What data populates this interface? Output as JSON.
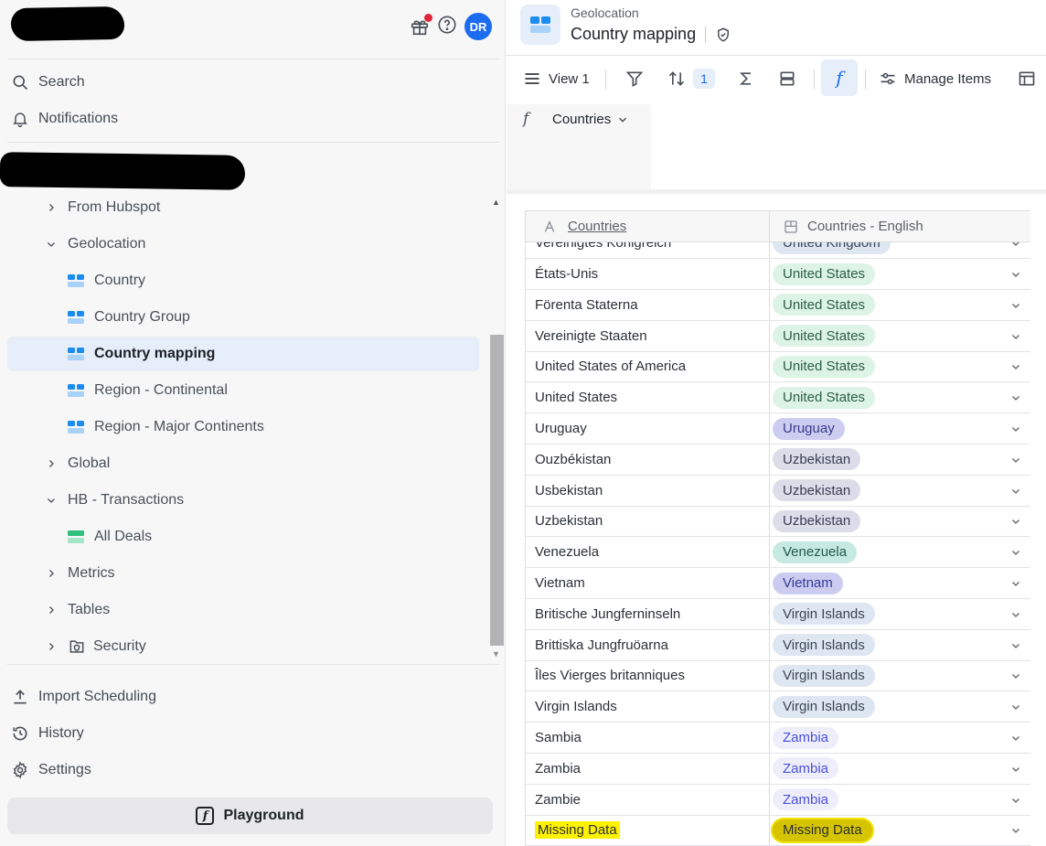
{
  "sidebar": {
    "avatar_initials": "DR",
    "nav": {
      "search": "Search",
      "notifications": "Notifications"
    },
    "tree": [
      {
        "label": "From Hubspot",
        "level": 1,
        "kind": "folder",
        "expanded": false
      },
      {
        "label": "Geolocation",
        "level": 1,
        "kind": "folder",
        "expanded": true
      },
      {
        "label": "Country",
        "level": 2,
        "kind": "table"
      },
      {
        "label": "Country Group",
        "level": 2,
        "kind": "table"
      },
      {
        "label": "Country mapping",
        "level": 2,
        "kind": "table",
        "selected": true
      },
      {
        "label": "Region - Continental",
        "level": 2,
        "kind": "table"
      },
      {
        "label": "Region - Major Continents",
        "level": 2,
        "kind": "table"
      },
      {
        "label": "Global",
        "level": 1,
        "kind": "folder",
        "expanded": false
      },
      {
        "label": "HB - Transactions",
        "level": 1,
        "kind": "folder",
        "expanded": true
      },
      {
        "label": "All Deals",
        "level": 2,
        "kind": "table-green"
      },
      {
        "label": "Metrics",
        "level": 1,
        "kind": "folder",
        "expanded": false
      },
      {
        "label": "Tables",
        "level": 1,
        "kind": "folder",
        "expanded": false
      },
      {
        "label": "Security",
        "level": 1,
        "kind": "folder-security",
        "expanded": false
      }
    ],
    "bottom": {
      "import_scheduling": "Import Scheduling",
      "history": "History",
      "settings": "Settings",
      "playground": "Playground"
    }
  },
  "header": {
    "subtitle": "Geolocation",
    "title": "Country mapping"
  },
  "toolbar": {
    "view_label": "View 1",
    "sort_count": "1",
    "manage_items": "Manage Items"
  },
  "formula": {
    "column_name": "Countries"
  },
  "table": {
    "columns": [
      "Countries",
      "Countries - English"
    ],
    "partial_row": {
      "c1": "Vereinigtes Königreich",
      "c2": "United Kingdom",
      "color": "uk"
    },
    "rows": [
      {
        "c1": "États-Unis",
        "c2": "United States",
        "color": "us"
      },
      {
        "c1": "Förenta Staterna",
        "c2": "United States",
        "color": "us"
      },
      {
        "c1": "Vereinigte Staaten",
        "c2": "United States",
        "color": "us"
      },
      {
        "c1": "United States of America",
        "c2": "United States",
        "color": "us"
      },
      {
        "c1": "United States",
        "c2": "United States",
        "color": "us"
      },
      {
        "c1": "Uruguay",
        "c2": "Uruguay",
        "color": "uy"
      },
      {
        "c1": "Ouzbékistan",
        "c2": "Uzbekistan",
        "color": "uz"
      },
      {
        "c1": "Usbekistan",
        "c2": "Uzbekistan",
        "color": "uz"
      },
      {
        "c1": "Uzbekistan",
        "c2": "Uzbekistan",
        "color": "uz"
      },
      {
        "c1": "Venezuela",
        "c2": "Venezuela",
        "color": "ve"
      },
      {
        "c1": "Vietnam",
        "c2": "Vietnam",
        "color": "vn"
      },
      {
        "c1": "Britische Jungferninseln",
        "c2": "Virgin Islands",
        "color": "vi"
      },
      {
        "c1": "Brittiska Jungfruöarna",
        "c2": "Virgin Islands",
        "color": "vi"
      },
      {
        "c1": "Îles Vierges britanniques",
        "c2": "Virgin Islands",
        "color": "vi"
      },
      {
        "c1": "Virgin Islands",
        "c2": "Virgin Islands",
        "color": "vi"
      },
      {
        "c1": "Sambia",
        "c2": "Zambia",
        "color": "zm"
      },
      {
        "c1": "Zambia",
        "c2": "Zambia",
        "color": "zm"
      },
      {
        "c1": "Zambie",
        "c2": "Zambia",
        "color": "zm"
      },
      {
        "c1": "Missing Data",
        "c2": "Missing Data",
        "color": "md",
        "highlighted": true
      }
    ],
    "pill_colors": {
      "uk": {
        "bg": "#dde6f1",
        "fg": "#3b4654"
      },
      "us": {
        "bg": "#dcf3e6",
        "fg": "#2f5e47"
      },
      "uy": {
        "bg": "#cccdf1",
        "fg": "#373a8c"
      },
      "uz": {
        "bg": "#dcdde9",
        "fg": "#3b3f55"
      },
      "ve": {
        "bg": "#c6e9e1",
        "fg": "#225a4e"
      },
      "vn": {
        "bg": "#ccccf0",
        "fg": "#343896"
      },
      "vi": {
        "bg": "#dde6f1",
        "fg": "#3b4654"
      },
      "zm": {
        "bg": "#eeeefb",
        "fg": "#4a4fd8"
      },
      "md": {
        "bg": "#d6c400",
        "fg": "#2b2f36"
      }
    }
  },
  "colors": {
    "accent": "#1c6cf0",
    "selected_bg": "#e5eef9",
    "highlight": "#fff200"
  }
}
